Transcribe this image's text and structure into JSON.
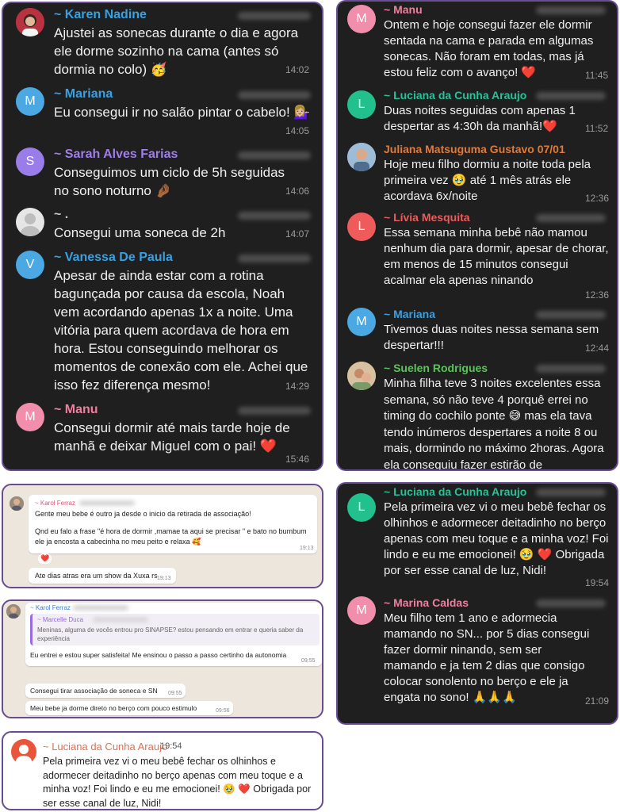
{
  "colors": {
    "border": "#6a4c93",
    "dark_bg": "#1f1f1f"
  },
  "panel1": {
    "messages": [
      {
        "name": "~ Karen Nadine",
        "name_color": "#3aa0e0",
        "text": "Ajustei as sonecas durante o dia e agora ele dorme sozinho na cama (antes só dormia no colo) 🥳",
        "time": "14:02",
        "avatar": "photo"
      },
      {
        "name": "~ Mariana",
        "name_color": "#3aa0e0",
        "text": "Eu consegui ir no salão pintar o cabelo! 💁🏼‍♀️",
        "time": "14:05",
        "avatar": "M",
        "avatar_color": "#4ba8e3"
      },
      {
        "name": "~ Sarah Alves Farias",
        "name_color": "#a07ee8",
        "text": "Conseguimos um ciclo de 5h seguidas no sono noturno 🤌🏾",
        "time": "14:06",
        "avatar": "S",
        "avatar_color": "#9a7de8"
      },
      {
        "name": "~ .",
        "name_color": "#c9c9c9",
        "text": "Consegui uma soneca de 2h",
        "time": "14:07",
        "avatar": "person"
      },
      {
        "name": "~ Vanessa De Paula",
        "name_color": "#3aa0e0",
        "text": "Apesar de ainda estar com a rotina bagunçada por causa da escola, Noah vem acordando apenas 1x a noite. Uma vitória para quem acordava de hora em hora. Estou conseguindo melhorar os momentos de conexão com ele. Achei que isso fez diferença mesmo!",
        "time": "14:29",
        "avatar": "V",
        "avatar_color": "#4ba8e3"
      },
      {
        "name": "~ Manu",
        "name_color": "#ef7fa0",
        "text": "Consegui dormir até mais tarde hoje de manhã e deixar Miguel com o pai! ❤️",
        "time": "15:46",
        "avatar": "M",
        "avatar_color": "#f08eac"
      }
    ]
  },
  "panel2": {
    "messages": [
      {
        "name": "~ Manu",
        "name_color": "#ef7fa0",
        "text": "Ontem e hoje consegui fazer ele dormir sentada na cama e parada em algumas sonecas. Não foram em todas, mas já estou feliz com o avanço! ❤️",
        "time": "11:45",
        "avatar": "M",
        "avatar_color": "#f08eac"
      },
      {
        "name": "~ Luciana da Cunha Araujo",
        "name_color": "#27c19a",
        "text": "Duas noites seguidas com apenas 1 despertar as 4:30h da manhã!❤️",
        "time": "11:52",
        "avatar": "L",
        "avatar_color": "#21c08d"
      },
      {
        "name": "Juliana Matsuguma Gustavo 07/01",
        "name_color": "#e07a3a",
        "text": "Hoje meu filho dormiu a noite toda pela primeira vez 🥹 até 1 mês atrás ele acordava 6x/noite",
        "time": "12:36",
        "avatar": "photo2"
      },
      {
        "name": "~ Lívia Mesquita",
        "name_color": "#ef5a5a",
        "text": "Essa semana minha bebê não mamou nenhum dia para dormir, apesar de chorar, em menos de 15 minutos consegui acalmar ela apenas ninando",
        "time": "12:36",
        "avatar": "L",
        "avatar_color": "#ef5a5a"
      },
      {
        "name": "~ Mariana",
        "name_color": "#3aa0e0",
        "text": "Tivemos duas noites nessa semana sem despertar!!!",
        "time": "12:44",
        "avatar": "M",
        "avatar_color": "#4ba8e3"
      },
      {
        "name": "~ Suelen Rodrigues",
        "name_color": "#5cc35c",
        "text": "Minha filha teve 3 noites excelentes essa semana, só não teve 4 porquê errei no timing do cochilo ponte 😅 mas ela tava tendo inúmeros despertares a noite 8 ou mais, dormindo no máximo 2horas. Agora ela conseguiu fazer estirão de",
        "time": "",
        "avatar": "photo3"
      }
    ]
  },
  "panel3": {
    "messages": [
      {
        "name": "~ Luciana da Cunha Araujo",
        "name_color": "#27c19a",
        "text": "Pela primeira vez vi o meu bebê fechar os olhinhos e adormecer deitadinho no berço apenas com meu toque e a minha voz! Foi lindo e eu me emocionei! 🥹 ❤️ Obrigada por ser esse canal de luz, Nidi!",
        "time": "19:54",
        "avatar": "L",
        "avatar_color": "#21c08d"
      },
      {
        "name": "~ Marina Caldas",
        "name_color": "#ef7fa0",
        "text": "Meu filho tem 1 ano e adormecia mamando no SN... por 5 dias consegui fazer dormir ninando, sem ser mamando e ja tem 2 dias que consigo colocar sonolento no berço e ele ja engata no sono! 🙏🙏🙏",
        "time": "21:09",
        "avatar": "M",
        "avatar_color": "#f08eac"
      }
    ]
  },
  "panel4": {
    "name": "~ Karol Ferraz",
    "text1": "Gente meu bebe é outro ja desde o inicio da retirada de associação!",
    "text2": "Qnd eu falo a frase \"é hora de dormir ,mamae ta aqui se precisar \" e bato no bumbum ele ja encosta a cabecinha no meu peito e relaxa 🥰",
    "time1": "19:13",
    "reaction": "❤️",
    "text3": "Ate dias atras era um show da Xuxa rs",
    "time2": "19:13"
  },
  "panel5": {
    "name": "~ Karol Ferraz",
    "quote_name": "~ Marcelle Duca",
    "quote_text": "Meninas, alguma de vocês entrou pro SINAPSE? estou pensando em entrar e queria saber da experiência",
    "text1": "Eu entrei e estou super satisfeita! Me ensinou o passo a passo certinho da autonomia",
    "time1": "09:55",
    "text2": "Consegui tirar associação de soneca e SN",
    "time2": "09:55",
    "text3": "Meu bebe ja dorme direto no berço com pouco estimulo",
    "time3": "09:56"
  },
  "panel6": {
    "name": "~ Luciana da Cunha Araujo",
    "time": "19:54",
    "text": "Pela primeira vez vi o meu bebê fechar os olhinhos e adormecer deitadinho no berço apenas com meu toque e a minha voz! Foi lindo e eu me emocionei! 🥹 ❤️ Obrigada por ser esse canal de luz, Nidi!"
  }
}
